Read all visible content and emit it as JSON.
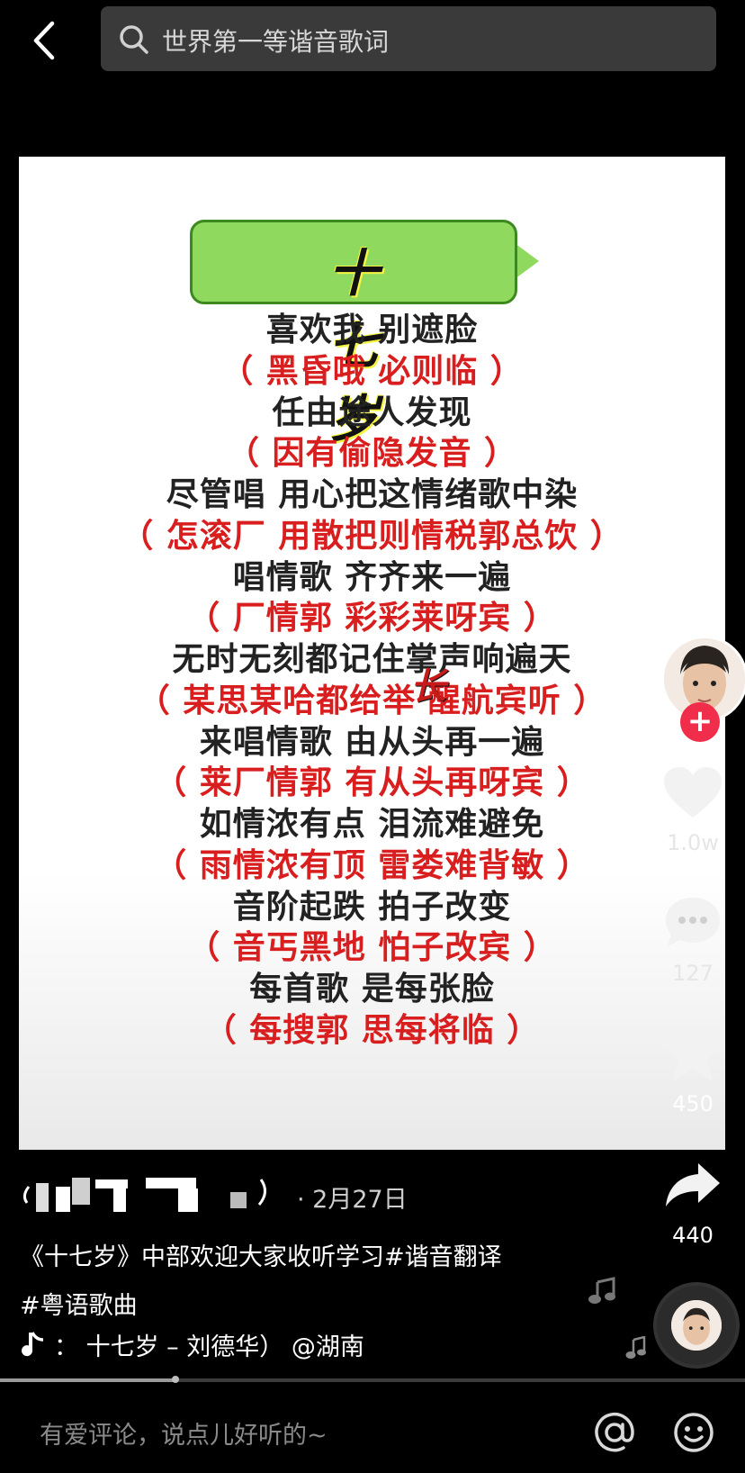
{
  "search": {
    "query": "世界第一等谐音歌词"
  },
  "video": {
    "title": "十 七 岁",
    "overlay_char": "长",
    "lyrics": [
      {
        "text": "喜欢我 别遮脸",
        "style": "cn"
      },
      {
        "text": "（ 黑昏哦 必则临 ）",
        "style": "yue"
      },
      {
        "text": "任由途人发现",
        "style": "cn"
      },
      {
        "text": "（ 因有偷隐发音 ）",
        "style": "yue"
      },
      {
        "text": "尽管唱 用心把这情绪歌中染",
        "style": "cn"
      },
      {
        "text": "（ 怎滚厂 用散把则情税郭总饮 ）",
        "style": "yue"
      },
      {
        "text": "唱情歌 齐齐来一遍",
        "style": "cn"
      },
      {
        "text": "（ 厂情郭 彩彩莱呀宾 ）",
        "style": "yue"
      },
      {
        "text": "无时无刻都记住掌声响遍天",
        "style": "cn"
      },
      {
        "text": "（ 某思某哈都给举 醒航宾听 ）",
        "style": "yue"
      },
      {
        "text": "来唱情歌 由从头再一遍",
        "style": "cn"
      },
      {
        "text": "（ 莱厂情郭 有从头再呀宾 ）",
        "style": "yue"
      },
      {
        "text": "如情浓有点 泪流难避免",
        "style": "cn"
      },
      {
        "text": "（ 雨情浓有顶 雷娄难背敏 ）",
        "style": "yue"
      },
      {
        "text": "音阶起跌 拍子改变",
        "style": "cn"
      },
      {
        "text": "（ 音丐黑地 怕子改宾 ）",
        "style": "yue"
      },
      {
        "text": "每首歌 是每张脸",
        "style": "cn"
      },
      {
        "text": "（ 每搜郭 思每将临 ）",
        "style": "yue"
      }
    ]
  },
  "rail": {
    "likes": "1.0w",
    "comments": "127",
    "favorites": "450",
    "shares": "440"
  },
  "post": {
    "date": "· 2月27日",
    "description_line1": "《十七岁》中部欢迎大家收听学习#谐音翻译",
    "description_line2": "#粤语歌曲",
    "music": "：  十七岁 – 刘德华）     @湖南"
  },
  "comment_bar": {
    "placeholder": "有爱评论，说点儿好听的~"
  },
  "progress": {
    "fraction": 0.235
  },
  "colors": {
    "accent_red": "#d81e1e",
    "follow_red": "#f02d4b",
    "title_green": "#8fd95f"
  }
}
